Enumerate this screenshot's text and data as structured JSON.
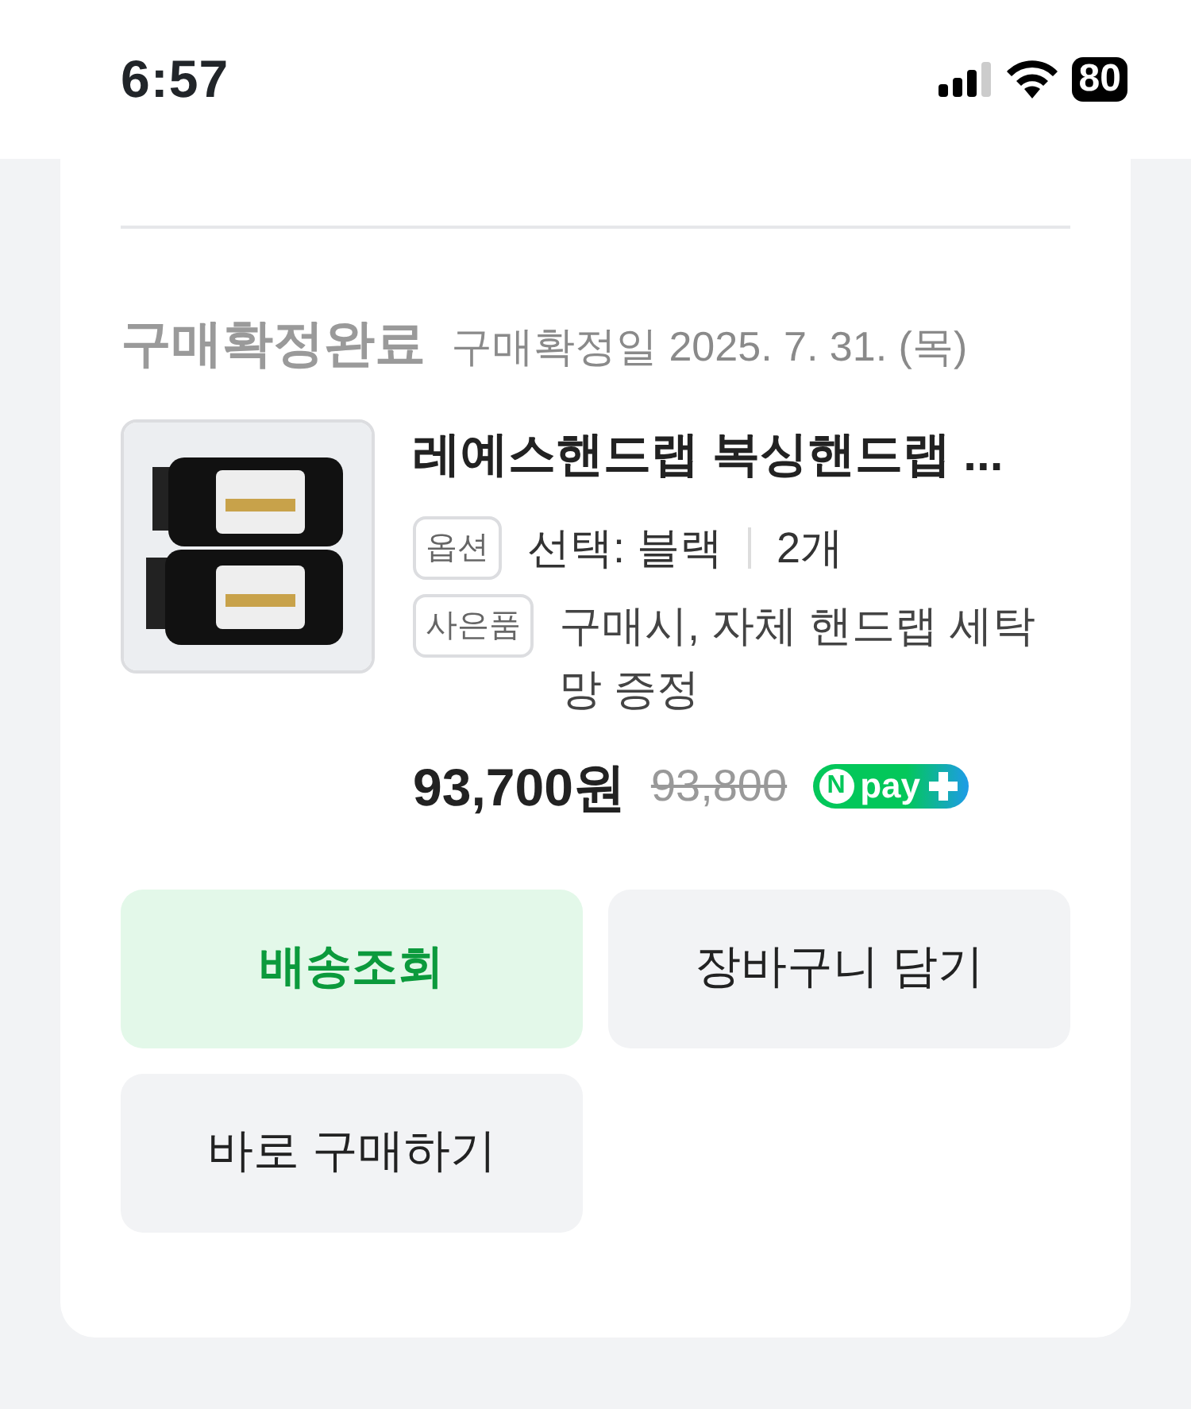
{
  "status_bar": {
    "time": "6:57",
    "battery": "80"
  },
  "order": {
    "status": "구매확정완료",
    "confirm_date": "구매확정일 2025. 7. 31. (목)",
    "product": {
      "title": "레예스핸드랩 복싱핸드랩 ...",
      "option": {
        "tag": "옵션",
        "value": "선택: 블랙",
        "quantity": "2개"
      },
      "gift": {
        "tag": "사은품",
        "value": "구매시, 자체 핸드랩 세탁망 증정"
      },
      "price": "93,700원",
      "original_price": "93,800",
      "npay": {
        "n": "N",
        "label": "pay"
      }
    },
    "buttons": [
      {
        "label": "배송조회",
        "kind": "primary"
      },
      {
        "label": "장바구니 담기",
        "kind": "secondary"
      },
      {
        "label": "바로 구매하기",
        "kind": "secondary"
      }
    ]
  }
}
